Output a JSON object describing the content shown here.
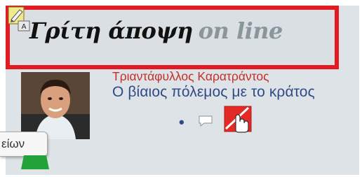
{
  "header": {
    "title_main": "Γρίτη άποψη",
    "title_suffix": "on line",
    "edit_badge_letter": "A",
    "border_color": "#e21b23"
  },
  "post": {
    "author": "Τριαντάφυλλος Καρατράντος",
    "title": "Ο βίαιος πόλεμος με το κράτος",
    "separator": "•",
    "author_color": "#c62f2a",
    "title_color": "#2f4a86"
  },
  "icons": {
    "edit": "edit-pencil-icon",
    "comment": "comment-bubble-icon",
    "hand": "hand-cursor-icon",
    "green_tab": "green-tab-icon"
  },
  "tooltip": {
    "text": "είων"
  }
}
